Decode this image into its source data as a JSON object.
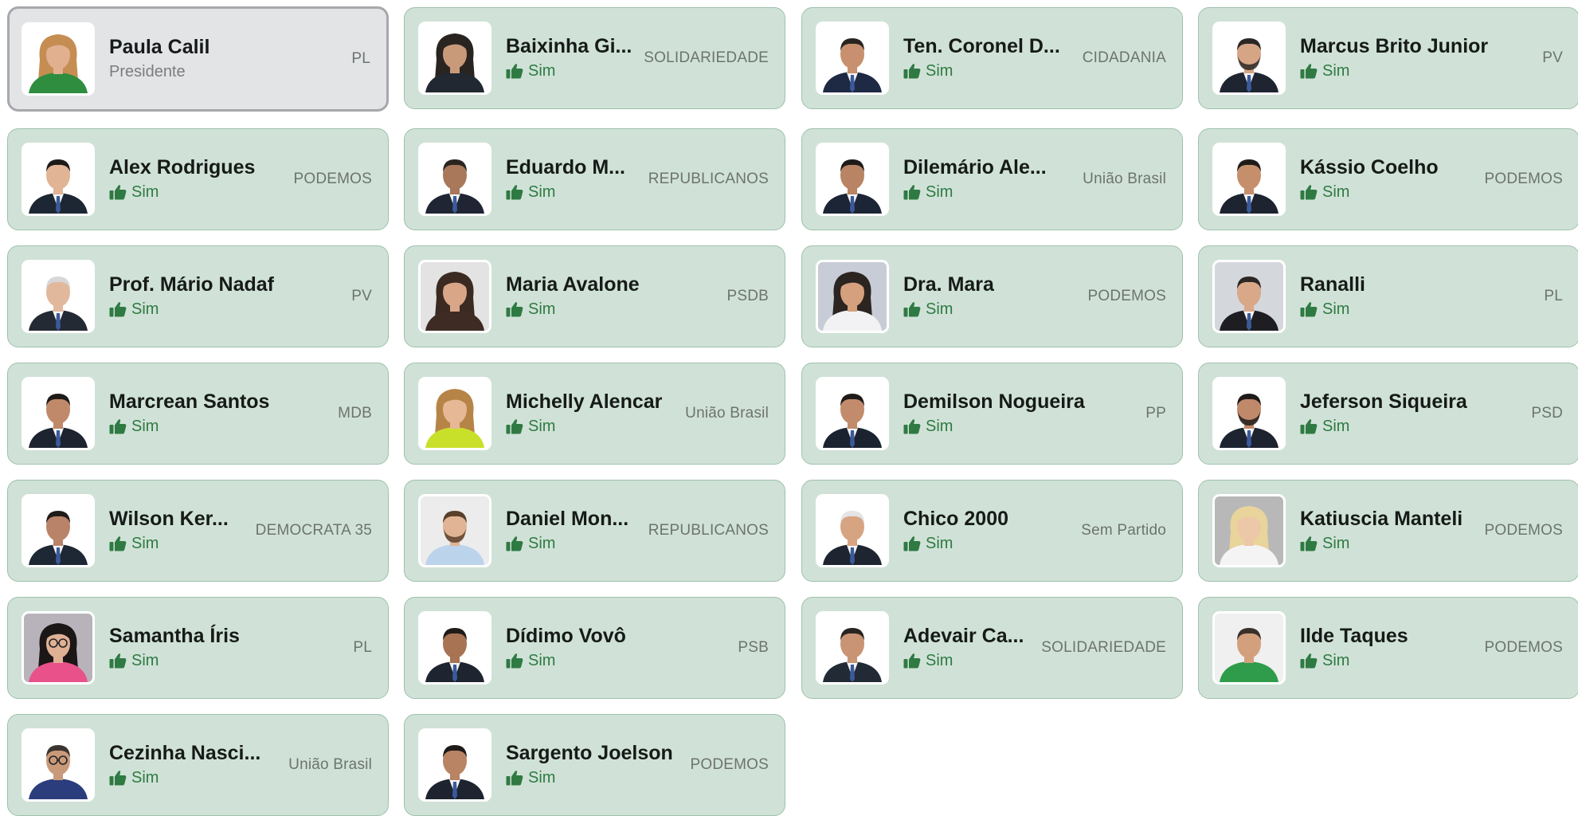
{
  "vote_label": "Sim",
  "colors": {
    "card_bg": "#d0e2d7",
    "card_border": "#9fc0ab",
    "president_bg": "#e3e4e6",
    "vote_green": "#2f7a43"
  },
  "icons": {
    "vote": "thumbs-up-icon"
  },
  "members": [
    {
      "name": "Paula Calil",
      "party": "PL",
      "role": "Presidente"
    },
    {
      "name": "Baixinha Gi...",
      "party": "SOLIDARIEDADE"
    },
    {
      "name": "Ten. Coronel D...",
      "party": "CIDADANIA"
    },
    {
      "name": "Marcus Brito Junior",
      "party": "PV"
    },
    {
      "name": "Alex Rodrigues",
      "party": "PODEMOS"
    },
    {
      "name": "Eduardo M...",
      "party": "REPUBLICANOS"
    },
    {
      "name": "Dilemário Ale...",
      "party": "União Brasil"
    },
    {
      "name": "Kássio Coelho",
      "party": "PODEMOS"
    },
    {
      "name": "Prof. Mário Nadaf",
      "party": "PV"
    },
    {
      "name": "Maria Avalone",
      "party": "PSDB"
    },
    {
      "name": "Dra. Mara",
      "party": "PODEMOS"
    },
    {
      "name": "Ranalli",
      "party": "PL"
    },
    {
      "name": "Marcrean Santos",
      "party": "MDB"
    },
    {
      "name": "Michelly Alencar",
      "party": "União Brasil"
    },
    {
      "name": "Demilson Nogueira",
      "party": "PP"
    },
    {
      "name": "Jeferson Siqueira",
      "party": "PSD"
    },
    {
      "name": "Wilson Ker...",
      "party": "DEMOCRATA 35"
    },
    {
      "name": "Daniel Mon...",
      "party": "REPUBLICANOS"
    },
    {
      "name": "Chico 2000",
      "party": "Sem Partido"
    },
    {
      "name": "Katiuscia Manteli",
      "party": "PODEMOS"
    },
    {
      "name": "Samantha Íris",
      "party": "PL"
    },
    {
      "name": "Dídimo Vovô",
      "party": "PSB"
    },
    {
      "name": "Adevair Ca...",
      "party": "SOLIDARIEDADE"
    },
    {
      "name": "Ilde Taques",
      "party": "PODEMOS"
    },
    {
      "name": "Cezinha Nasci...",
      "party": "União Brasil"
    },
    {
      "name": "Sargento Joelson",
      "party": "PODEMOS"
    }
  ]
}
